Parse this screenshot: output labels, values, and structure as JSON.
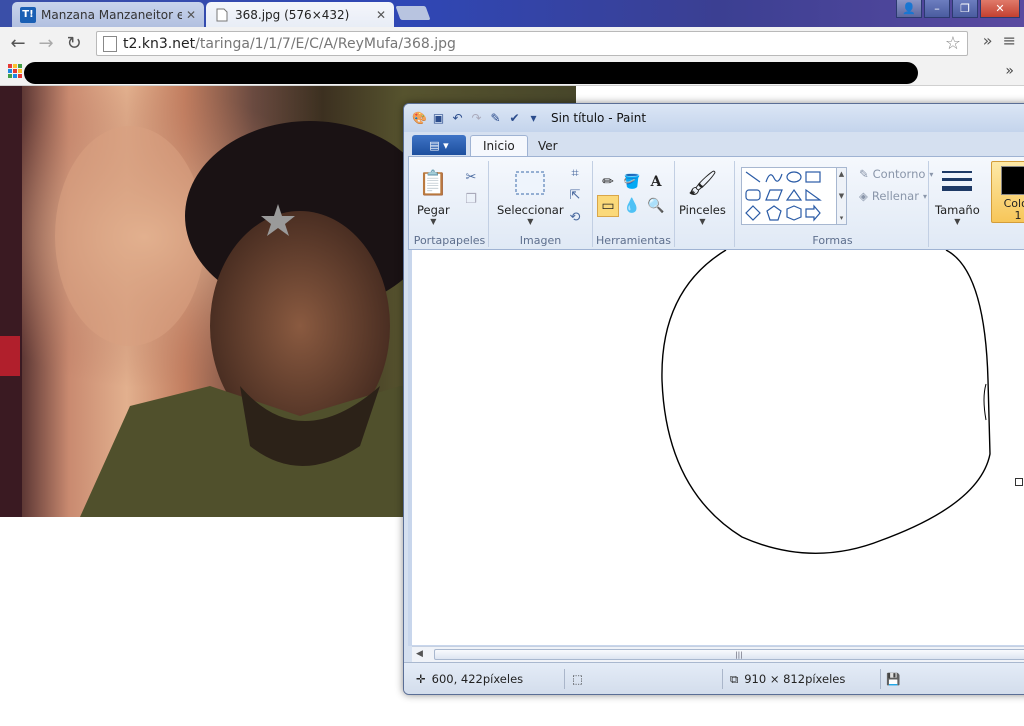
{
  "browser": {
    "tabs": [
      {
        "label": "Manzana Manzaneitor en",
        "favicon": "T!"
      },
      {
        "label": "368.jpg (576×432)"
      }
    ],
    "address": {
      "host": "t2.kn3.net",
      "path": "/taringa/1/1/7/E/C/A/ReyMufa/368.jpg"
    },
    "icons": {
      "back": "back-arrow-icon",
      "forward": "forward-arrow-icon",
      "reload": "reload-icon",
      "bookmark_star": "star-icon",
      "menu": "hamburger-menu-icon"
    }
  },
  "paint": {
    "window_title": "Sin título - Paint",
    "ribbon_tabs": [
      "Inicio",
      "Ver"
    ],
    "groups": {
      "clipboard": {
        "label": "Portapapeles",
        "paste": "Pegar"
      },
      "image": {
        "label": "Imagen",
        "select": "Seleccionar"
      },
      "tools": {
        "label": "Herramientas"
      },
      "brushes": {
        "label": "Pinceles"
      },
      "shapes": {
        "label": "Formas",
        "outline": "Contorno",
        "fill": "Rellenar"
      },
      "size": {
        "label": "Tamaño"
      },
      "color1": {
        "label_line1": "Color",
        "label_line2": "1",
        "value": "#000000"
      }
    },
    "status": {
      "cursor": "600, 422píxeles",
      "image_size": "910 × 812píxeles"
    },
    "accent": "#f7c659"
  }
}
